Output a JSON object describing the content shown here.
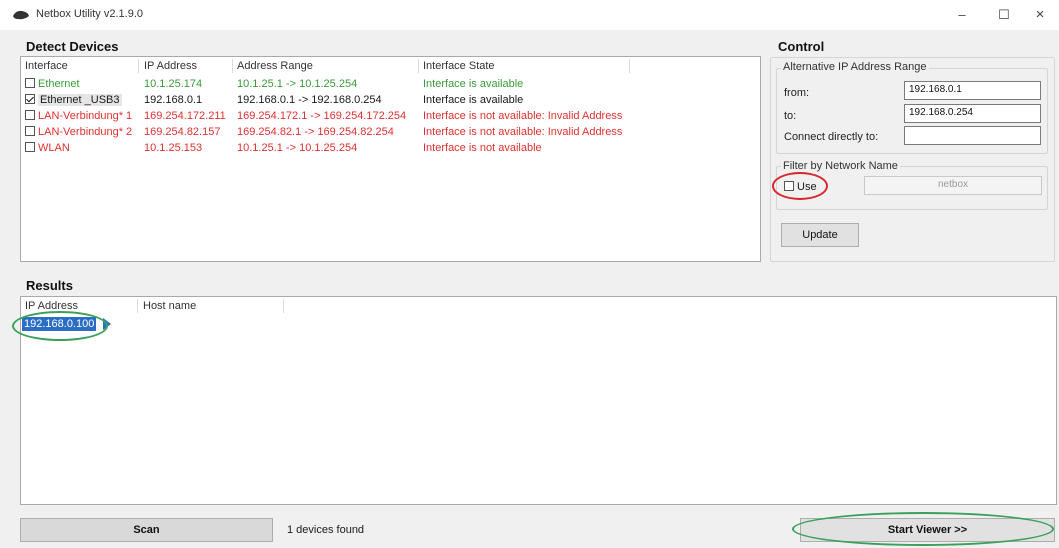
{
  "window": {
    "title": "Netbox Utility v2.1.9.0",
    "minimize": "–",
    "maximize": "☐",
    "close": "×"
  },
  "colors": {
    "available": "#3a9a3a",
    "unavailable": "#e03030",
    "normal": "#1a1a1a",
    "selection": "#2a6dc4"
  },
  "detect": {
    "title": "Detect Devices",
    "columns": [
      "Interface",
      "IP Address",
      "Address Range",
      "Interface State"
    ],
    "rows": [
      {
        "interface": "Ethernet",
        "checked": false,
        "ip": "10.1.25.174",
        "range": "10.1.25.1 -> 10.1.25.254",
        "state": "Interface is available",
        "status": "available"
      },
      {
        "interface": "Ethernet _USB3",
        "checked": true,
        "ip": "192.168.0.1",
        "range": "192.168.0.1 -> 192.168.0.254",
        "state": "Interface is available",
        "status": "normal"
      },
      {
        "interface": "LAN-Verbindung* 1",
        "checked": false,
        "ip": "169.254.172.211",
        "range": "169.254.172.1 -> 169.254.172.254",
        "state": "Interface is not available: Invalid Address",
        "status": "unavailable"
      },
      {
        "interface": "LAN-Verbindung* 2",
        "checked": false,
        "ip": "169.254.82.157",
        "range": "169.254.82.1 -> 169.254.82.254",
        "state": "Interface is not available: Invalid Address",
        "status": "unavailable"
      },
      {
        "interface": "WLAN",
        "checked": false,
        "ip": "10.1.25.153",
        "range": "10.1.25.1 -> 10.1.25.254",
        "state": "Interface is not available",
        "status": "unavailable"
      }
    ]
  },
  "control": {
    "title": "Control",
    "alt_range_label": "Alternative IP Address Range",
    "from_label": "from:",
    "from_value": "192.168.0.1",
    "to_label": "to:",
    "to_value": "192.168.0.254",
    "direct_label": "Connect directly to:",
    "direct_value": "",
    "filter_label": "Filter by Network Name",
    "use_label": "Use",
    "network_name": "netbox",
    "update_button": "Update"
  },
  "results": {
    "title": "Results",
    "columns": [
      "IP Address",
      "Host name"
    ],
    "rows": [
      {
        "ip": "192.168.0.100",
        "hostname": ""
      }
    ]
  },
  "footer": {
    "scan_button": "Scan",
    "status": "1 devices found",
    "start_button": "Start Viewer >>"
  }
}
